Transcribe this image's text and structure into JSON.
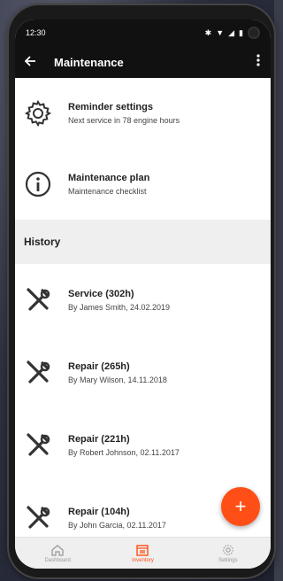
{
  "status_bar": {
    "time": "12:30",
    "icons": [
      "bluetooth-icon",
      "wifi-icon",
      "signal-icon",
      "battery-icon"
    ]
  },
  "app_bar": {
    "title": "Maintenance",
    "back_icon": "arrow-left-icon",
    "menu_icon": "more-vert-icon"
  },
  "settings_items": [
    {
      "title": "Reminder settings",
      "subtitle": "Next service in 78 engine hours",
      "icon": "gear-icon"
    },
    {
      "title": "Maintenance plan",
      "subtitle": "Maintenance checklist",
      "icon": "info-icon"
    }
  ],
  "history": {
    "header": "History",
    "items": [
      {
        "title": "Service (302h)",
        "subtitle": "By James Smith, 24.02.2019",
        "icon": "tools-icon"
      },
      {
        "title": "Repair (265h)",
        "subtitle": "By Mary Wilson, 14.11.2018",
        "icon": "tools-icon"
      },
      {
        "title": "Repair (221h)",
        "subtitle": "By Robert Johnson, 02.11.2017",
        "icon": "tools-icon"
      },
      {
        "title": "Repair (104h)",
        "subtitle": "By John Garcia, 02.11.2017",
        "icon": "tools-icon"
      }
    ]
  },
  "fab": {
    "label": "+",
    "icon": "plus-icon"
  },
  "bottom_nav": {
    "items": [
      {
        "label": "Dashboard",
        "icon": "home-icon",
        "active": false
      },
      {
        "label": "Inventory",
        "icon": "inventory-icon",
        "active": true
      },
      {
        "label": "Settings",
        "icon": "gear-icon",
        "active": false
      }
    ]
  },
  "colors": {
    "accent": "#ff4f16",
    "appbar": "#111111",
    "section_bg": "#efefef"
  }
}
